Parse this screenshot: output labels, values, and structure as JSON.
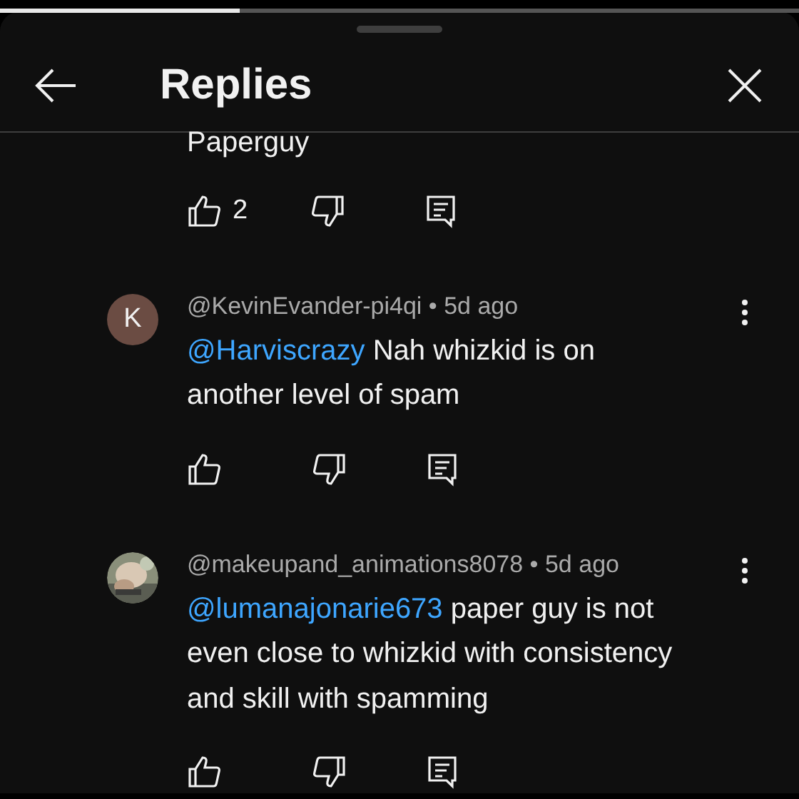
{
  "progress": {
    "level": 0.3
  },
  "sheet": {
    "title": "Replies"
  },
  "partial_comment": {
    "text": "Paperguy",
    "likes": "2"
  },
  "comments": [
    {
      "avatar": {
        "kind": "letter",
        "letter": "K",
        "color": "#6b4c43"
      },
      "meta": "@KevinEvander-pi4qi • 5d ago",
      "mention": "@Harviscrazy",
      "text": "Nah whizkid is on another level of spam"
    },
    {
      "meta": "@makeupand_animations8078 • 5d ago",
      "mention": "@lumanajonarie673",
      "text": "paper guy is not even close to whizkid with consistency and skill with spamming"
    }
  ]
}
